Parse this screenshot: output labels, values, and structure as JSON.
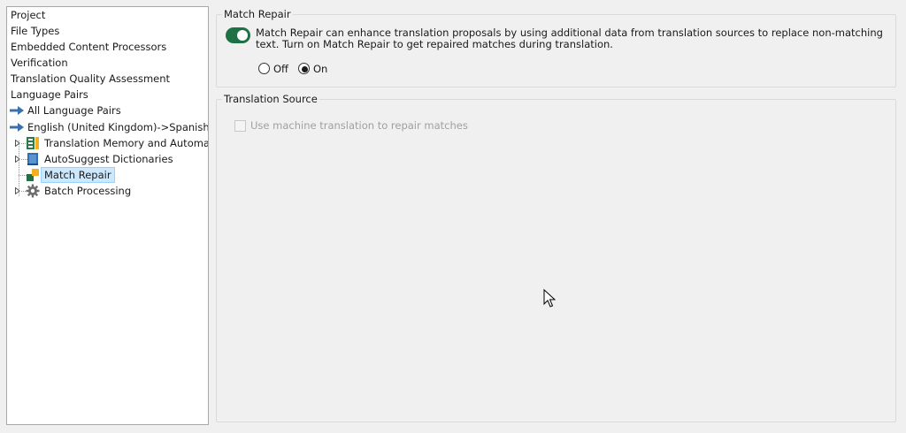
{
  "tree": {
    "items": [
      {
        "label": "Project"
      },
      {
        "label": "File Types"
      },
      {
        "label": "Embedded Content Processors"
      },
      {
        "label": "Verification"
      },
      {
        "label": "Translation Quality Assessment"
      },
      {
        "label": "Language Pairs"
      },
      {
        "label": "All Language Pairs",
        "icon": "arrow-right-icon"
      },
      {
        "label": "English (United Kingdom)->Spanish (Sp",
        "icon": "arrow-right-icon"
      },
      {
        "label": "Translation Memory and Automated",
        "icon": "translation-memory-icon"
      },
      {
        "label": "AutoSuggest Dictionaries",
        "icon": "dictionary-icon"
      },
      {
        "label": "Match Repair",
        "icon": "match-repair-icon",
        "selected": true
      },
      {
        "label": "Batch Processing",
        "icon": "gear-icon"
      }
    ]
  },
  "match_repair": {
    "title": "Match Repair",
    "toggle_on": true,
    "description": "Match Repair can enhance translation proposals by using additional data from translation sources to replace non-matching text. Turn on Match Repair to get repaired matches during translation.",
    "option_off": "Off",
    "option_on": "On",
    "selected": "On"
  },
  "translation_source": {
    "title": "Translation Source",
    "checkbox_label": "Use machine translation to repair matches",
    "checkbox_checked": false,
    "checkbox_enabled": false
  },
  "colors": {
    "accent_green": "#1e7145",
    "arrow_blue": "#3a6fb0",
    "selection": "#cce8ff"
  }
}
